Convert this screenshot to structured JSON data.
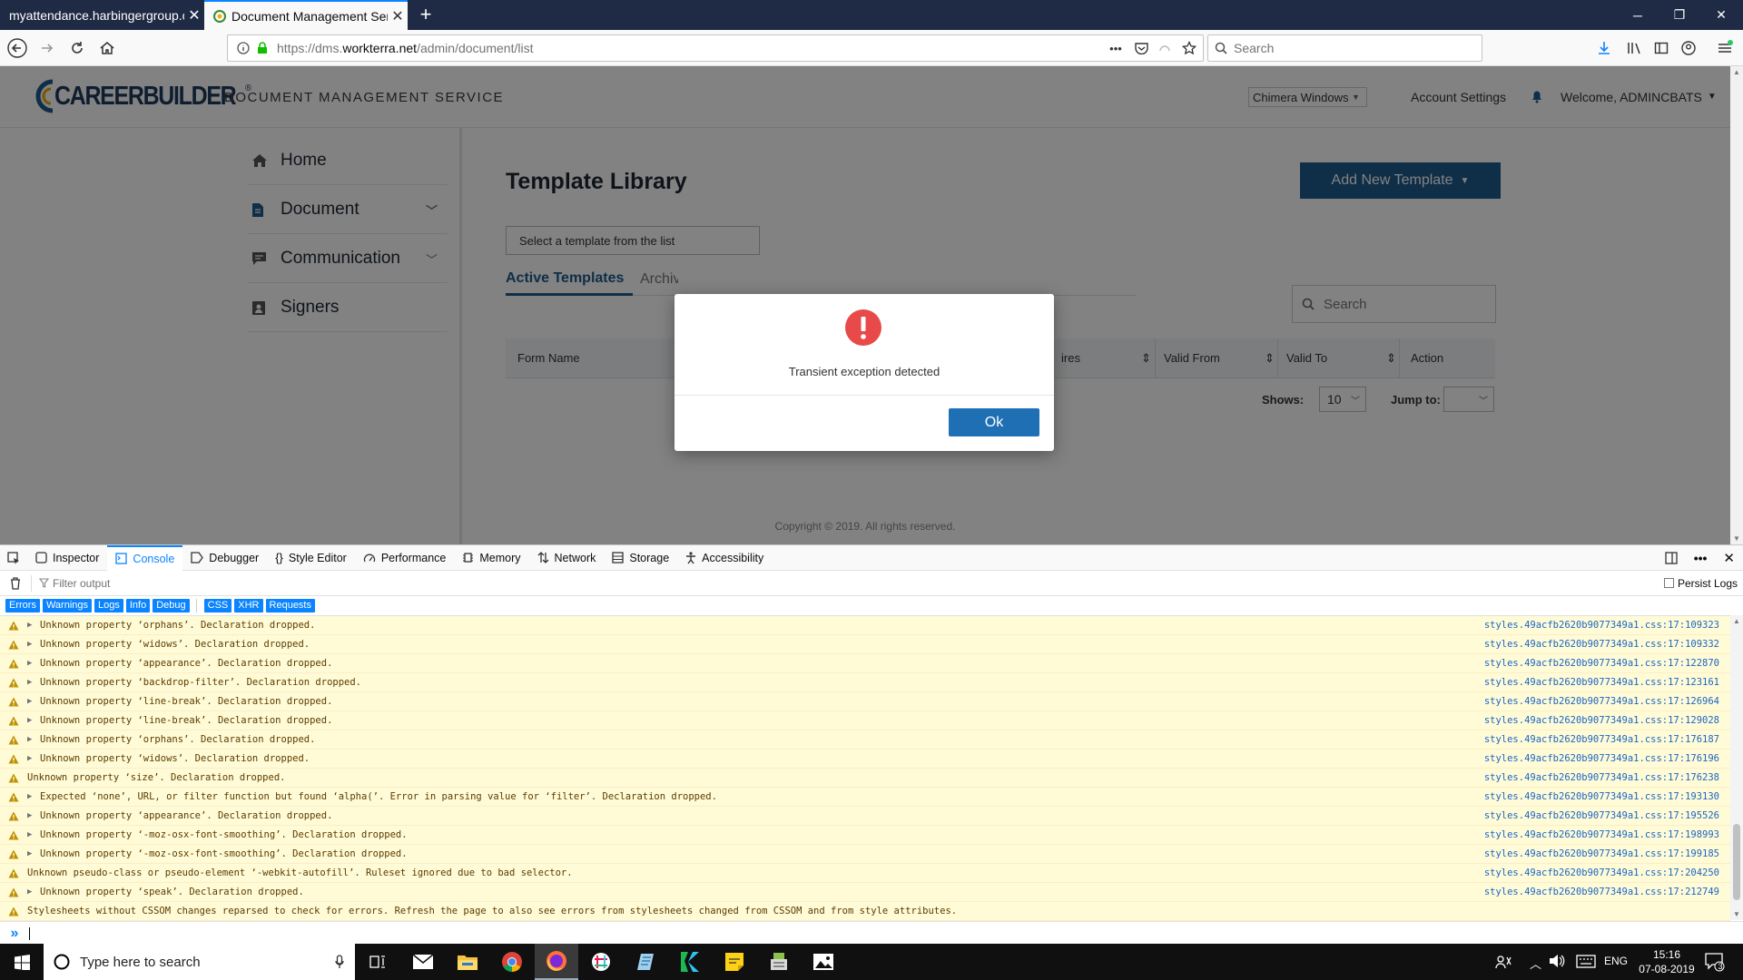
{
  "browser": {
    "tabs": [
      {
        "title": "myattendance.harbingergroup.com",
        "active": false
      },
      {
        "title": "Document Management Servic",
        "active": true
      }
    ],
    "new_tab": "+",
    "url": "https://dms.workterra.net/admin/document/list",
    "url_prefix": "https://dms.",
    "url_host": "workterra.net",
    "url_path": "/admin/document/list",
    "search_placeholder": "Search",
    "url_more": "•••"
  },
  "app": {
    "logo_text": "CAREERBUILDER",
    "logo_reg": "®",
    "service_name": "DOCUMENT MANAGEMENT SERVICE",
    "client_select": "Chimera Windows",
    "account_settings": "Account Settings",
    "welcome": "Welcome, ADMINCBATS",
    "copyright": "Copyright © 2019. All rights reserved."
  },
  "sidebar": {
    "items": [
      {
        "label": "Home",
        "icon": "home-icon",
        "expandable": false
      },
      {
        "label": "Document",
        "icon": "document-icon",
        "expandable": true
      },
      {
        "label": "Communication",
        "icon": "chat-icon",
        "expandable": true
      },
      {
        "label": "Signers",
        "icon": "signers-icon",
        "expandable": false
      }
    ]
  },
  "main": {
    "title": "Template Library",
    "add_button": "Add New Template",
    "template_select": "Select a template from the list",
    "tabs": [
      "Active Templates",
      "Archiv"
    ],
    "search_placeholder": "Search",
    "columns": [
      "Form Name",
      "ires",
      "Valid From",
      "Valid To",
      "Action"
    ],
    "shows_label": "Shows:",
    "shows_value": "10",
    "jump_label": "Jump to:"
  },
  "dialog": {
    "message": "Transient exception detected",
    "ok": "Ok",
    "icon": "exclamation-icon",
    "icon_color": "#e84a4a"
  },
  "devtools": {
    "tabs": [
      "Inspector",
      "Console",
      "Debugger",
      "Style Editor",
      "Performance",
      "Memory",
      "Network",
      "Storage",
      "Accessibility"
    ],
    "active_tab": "Console",
    "filter_placeholder": "Filter output",
    "persist_logs": "Persist Logs",
    "filter_buttons": [
      "Errors",
      "Warnings",
      "Logs",
      "Info",
      "Debug",
      "CSS",
      "XHR",
      "Requests"
    ],
    "messages": [
      {
        "text": "Unknown property ‘orphans’.  Declaration dropped.",
        "src": "styles.49acfb2620b9077349a1.css:17:109323",
        "twisty": true
      },
      {
        "text": "Unknown property ‘widows’.  Declaration dropped.",
        "src": "styles.49acfb2620b9077349a1.css:17:109332",
        "twisty": true
      },
      {
        "text": "Unknown property ‘appearance’.  Declaration dropped.",
        "src": "styles.49acfb2620b9077349a1.css:17:122870",
        "twisty": true
      },
      {
        "text": "Unknown property ‘backdrop-filter’.  Declaration dropped.",
        "src": "styles.49acfb2620b9077349a1.css:17:123161",
        "twisty": true
      },
      {
        "text": "Unknown property ‘line-break’.  Declaration dropped.",
        "src": "styles.49acfb2620b9077349a1.css:17:126964",
        "twisty": true
      },
      {
        "text": "Unknown property ‘line-break’.  Declaration dropped.",
        "src": "styles.49acfb2620b9077349a1.css:17:129028",
        "twisty": true
      },
      {
        "text": "Unknown property ‘orphans’.  Declaration dropped.",
        "src": "styles.49acfb2620b9077349a1.css:17:176187",
        "twisty": true
      },
      {
        "text": "Unknown property ‘widows’.  Declaration dropped.",
        "src": "styles.49acfb2620b9077349a1.css:17:176196",
        "twisty": true
      },
      {
        "text": "Unknown property ‘size’.  Declaration dropped.",
        "src": "styles.49acfb2620b9077349a1.css:17:176238",
        "twisty": false
      },
      {
        "text": "Expected ‘none’, URL, or filter function but found ‘alpha(’.  Error in parsing value for ‘filter’.  Declaration dropped.",
        "src": "styles.49acfb2620b9077349a1.css:17:193130",
        "twisty": true
      },
      {
        "text": "Unknown property ‘appearance’.  Declaration dropped.",
        "src": "styles.49acfb2620b9077349a1.css:17:195526",
        "twisty": true
      },
      {
        "text": "Unknown property ‘-moz-osx-font-smoothing’.  Declaration dropped.",
        "src": "styles.49acfb2620b9077349a1.css:17:198993",
        "twisty": true
      },
      {
        "text": "Unknown property ‘-moz-osx-font-smoothing’.  Declaration dropped.",
        "src": "styles.49acfb2620b9077349a1.css:17:199185",
        "twisty": true
      },
      {
        "text": "Unknown pseudo-class or pseudo-element ‘-webkit-autofill’.  Ruleset ignored due to bad selector.",
        "src": "styles.49acfb2620b9077349a1.css:17:204250",
        "twisty": false
      },
      {
        "text": "Unknown property ‘speak’.  Declaration dropped.",
        "src": "styles.49acfb2620b9077349a1.css:17:212749",
        "twisty": true
      },
      {
        "text": "Stylesheets without CSSOM changes reparsed to check for errors. Refresh the page to also see errors from stylesheets changed from CSSOM and from style attributes.",
        "src": "",
        "twisty": false
      }
    ],
    "prompt": "»"
  },
  "taskbar": {
    "search_placeholder": "Type here to search",
    "language": "ENG",
    "time": "15:16",
    "date": "07-08-2019",
    "notifications": "3"
  },
  "colors": {
    "brand_blue": "#1e5a8e",
    "ok_blue": "#1f6fb5",
    "link_blue": "#1b65c7",
    "warn_bg": "#fffbd6"
  }
}
